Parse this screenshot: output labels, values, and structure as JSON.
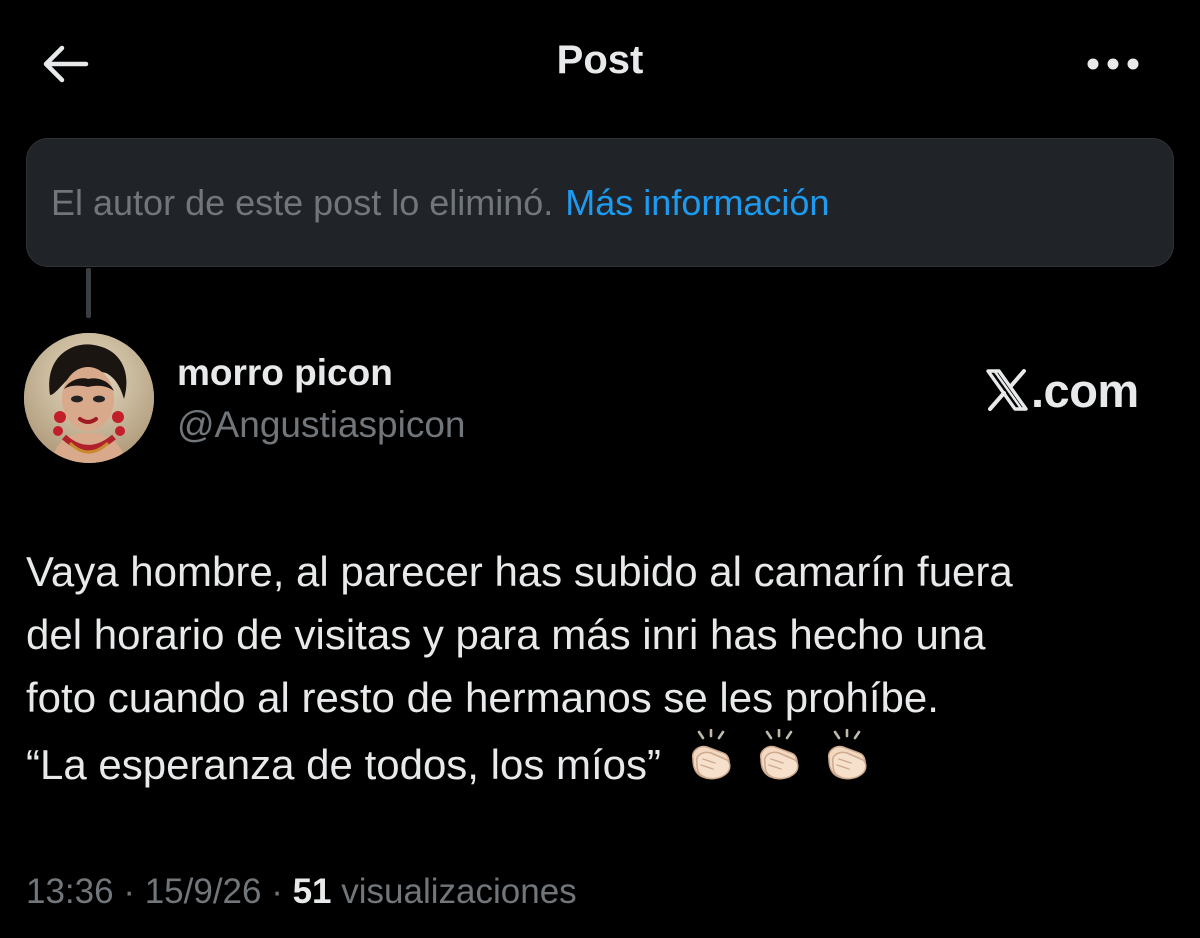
{
  "header": {
    "title": "Post",
    "back_icon": "arrow-left-icon",
    "more_icon": "more-horizontal-icon"
  },
  "deleted_notice": {
    "text": "El autor de este post lo eliminó.",
    "link": "Más información"
  },
  "author": {
    "name": "morro picon",
    "handle": "@Angustiaspicon"
  },
  "watermark": {
    "letter": "𝕏",
    "text": ".com"
  },
  "post": {
    "lines": [
      "Vaya hombre, al parecer has subido al camarín fuera",
      "del horario de visitas y para más inri has hecho una",
      "foto cuando al resto de hermanos se les prohíbe.",
      "“La esperanza de todos, los míos”"
    ],
    "emojis": [
      "clapping-hands-icon",
      "clapping-hands-icon",
      "clapping-hands-icon"
    ]
  },
  "meta": {
    "time": "13:36",
    "date": "15/9/26",
    "views_count": "51",
    "views_label": "visualizaciones"
  },
  "colors": {
    "background": "#000000",
    "text_primary": "#e7e9ea",
    "text_secondary": "#71767b",
    "link": "#1d9bf0",
    "notice_bg": "#202327"
  }
}
